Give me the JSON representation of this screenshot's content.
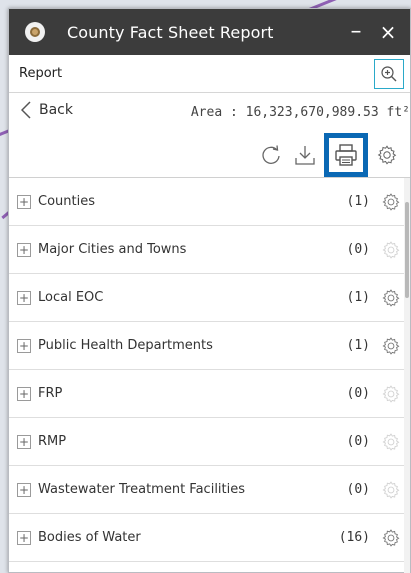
{
  "window": {
    "title": "County Fact Sheet Report",
    "minimize_label": "–",
    "close_label": "×"
  },
  "subbar": {
    "label": "Report"
  },
  "toolbar": {
    "back_label": "Back",
    "area_text": "Area : 16,323,670,989.53 ft²"
  },
  "layers": [
    {
      "label": "Counties",
      "count": "(1)",
      "gear_active": true
    },
    {
      "label": "Major Cities and Towns",
      "count": "(0)",
      "gear_active": false
    },
    {
      "label": "Local EOC",
      "count": "(1)",
      "gear_active": true
    },
    {
      "label": "Public Health Departments",
      "count": "(1)",
      "gear_active": true
    },
    {
      "label": "FRP",
      "count": "(0)",
      "gear_active": false
    },
    {
      "label": "RMP",
      "count": "(0)",
      "gear_active": false
    },
    {
      "label": "Wastewater Treatment Facilities",
      "count": "(0)",
      "gear_active": false
    },
    {
      "label": "Bodies of Water",
      "count": "(16)",
      "gear_active": true
    }
  ],
  "expander_symbol": "+",
  "colors": {
    "titlebar": "#3c3c3c",
    "print_highlight": "#0a68b4",
    "zoom_border": "#2aa9c9",
    "gear_active": "#777777",
    "gear_inactive": "#d2d2d2"
  }
}
